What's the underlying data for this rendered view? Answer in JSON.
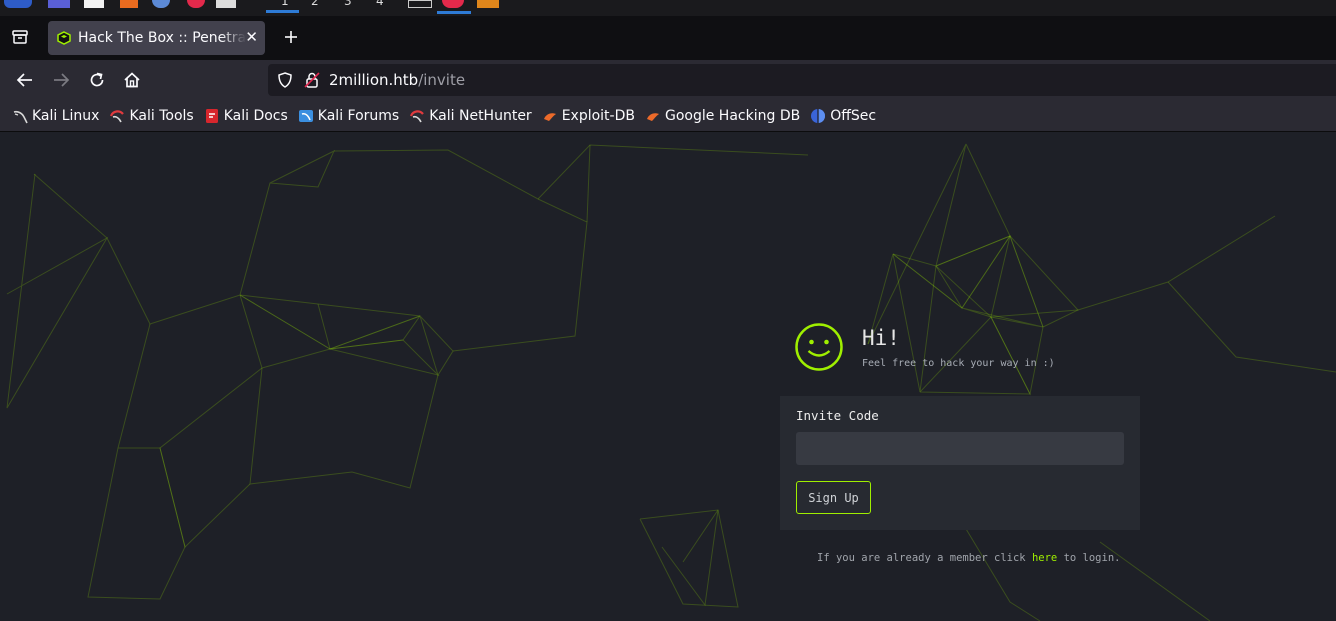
{
  "taskbar": {
    "workspaces": [
      "1",
      "2",
      "3",
      "4"
    ]
  },
  "browser": {
    "tab": {
      "title": "Hack The Box :: Penetration Testing Labs"
    },
    "url": {
      "host": "2million.htb",
      "path": "/invite"
    },
    "bookmarks": [
      {
        "label": "Kali Linux",
        "icon": "kali-dragon-icon"
      },
      {
        "label": "Kali Tools",
        "icon": "kali-tools-icon"
      },
      {
        "label": "Kali Docs",
        "icon": "kali-docs-icon"
      },
      {
        "label": "Kali Forums",
        "icon": "kali-forums-icon"
      },
      {
        "label": "Kali NetHunter",
        "icon": "kali-nethunter-icon"
      },
      {
        "label": "Exploit-DB",
        "icon": "exploit-db-icon"
      },
      {
        "label": "Google Hacking DB",
        "icon": "ghdb-icon"
      },
      {
        "label": "OffSec",
        "icon": "offsec-icon"
      }
    ]
  },
  "page": {
    "greeting": "Hi!",
    "tagline": "Feel free to hack your way in :)",
    "form": {
      "label": "Invite Code",
      "value": "",
      "button": "Sign Up"
    },
    "login_prefix": "If you are already a member click",
    "login_link": "here",
    "login_suffix": "to login."
  },
  "colors": {
    "accent": "#9fef00",
    "page_bg": "#1e2027",
    "card_bg": "#272a31"
  }
}
